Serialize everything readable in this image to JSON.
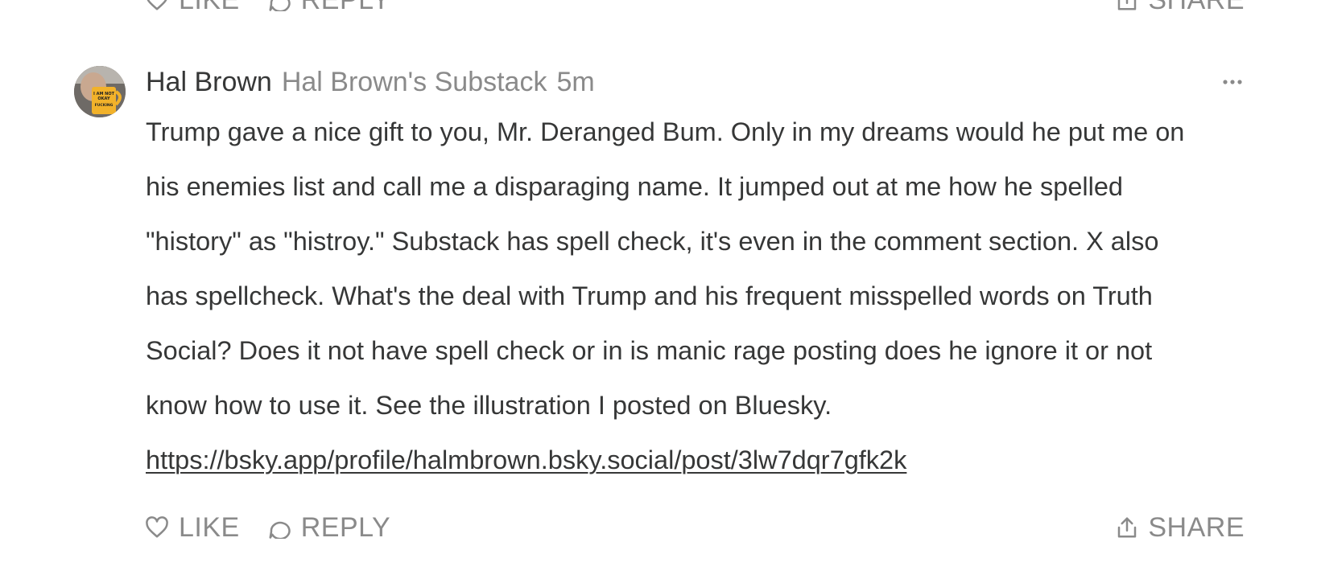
{
  "prev_actions": {
    "like_label": "LIKE",
    "reply_label": "REPLY",
    "share_label": "SHARE"
  },
  "comment": {
    "author": "Hal Brown",
    "publication": "Hal Brown's Substack",
    "time": "5m",
    "more_icon": "ellipsis-icon",
    "body_text": "Trump gave a nice gift to you, Mr. Deranged Bum. Only in my dreams would he put me on his enemies list and call me a disparaging name. It jumped out at me how he spelled \"history\" as \"histroy.\" Substack has spell check, it's even in the comment section. X also has spellcheck. What's the deal with Trump and his frequent misspelled words on Truth Social? Does it not have spell check or in is manic rage posting does he ignore it or not know how to use it. See the illustration I posted on Bluesky. ",
    "link_text": "https://bsky.app/profile/halmbrown.bsky.social/post/3lw7dqr7gfk2k",
    "avatar_mug_text": "I AM NOT OKAY FUCKING",
    "actions": {
      "like_label": "LIKE",
      "reply_label": "REPLY",
      "share_label": "SHARE"
    }
  },
  "colors": {
    "text": "#363737",
    "muted": "#8a8a8a",
    "background": "#ffffff"
  }
}
